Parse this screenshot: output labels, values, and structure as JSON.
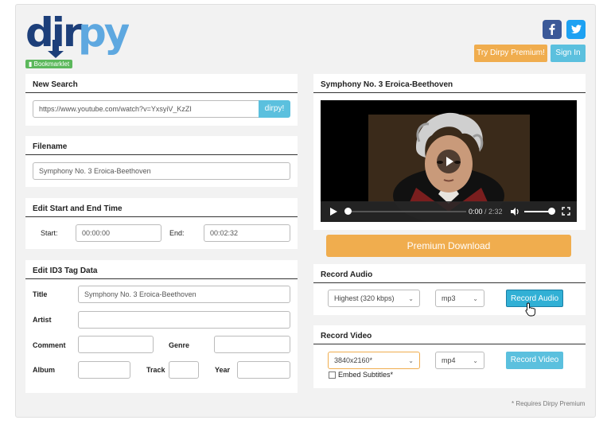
{
  "logo": {
    "text": "dirpy",
    "bookmarklet_label": "Bookmarklet"
  },
  "header": {
    "premium_button": "Try Dirpy Premium!",
    "signin_button": "Sign In",
    "social": [
      "facebook-icon",
      "twitter-icon"
    ]
  },
  "new_search": {
    "title": "New Search",
    "url_value": "https://www.youtube.com/watch?v=YxsyiV_KzZI",
    "button": "dirpy!"
  },
  "filename": {
    "title": "Filename",
    "value": "Symphony No. 3 Eroica-Beethoven"
  },
  "time": {
    "title": "Edit Start and End Time",
    "start_label": "Start:",
    "start_value": "00:00:00",
    "end_label": "End:",
    "end_value": "00:02:32"
  },
  "id3": {
    "title": "Edit ID3 Tag Data",
    "title_label": "Title",
    "title_value": "Symphony No. 3 Eroica-Beethoven",
    "artist_label": "Artist",
    "comment_label": "Comment",
    "genre_label": "Genre",
    "album_label": "Album",
    "track_label": "Track",
    "year_label": "Year"
  },
  "preview": {
    "title": "Symphony No. 3 Eroica-Beethoven",
    "current_time": "0:00",
    "separator": " / ",
    "duration": "2:32"
  },
  "premium_download": "Premium Download",
  "record_audio": {
    "title": "Record Audio",
    "quality": "Highest (320 kbps)",
    "format": "mp3",
    "button": "Record Audio"
  },
  "record_video": {
    "title": "Record Video",
    "resolution": "3840x2160*",
    "format": "mp4",
    "button": "Record Video",
    "subtitles_label": "Embed Subtitles*"
  },
  "footnote": "* Requires Dirpy Premium",
  "colors": {
    "orange": "#f0ad4e",
    "blue": "#5bc0de",
    "green": "#5cb85c"
  }
}
